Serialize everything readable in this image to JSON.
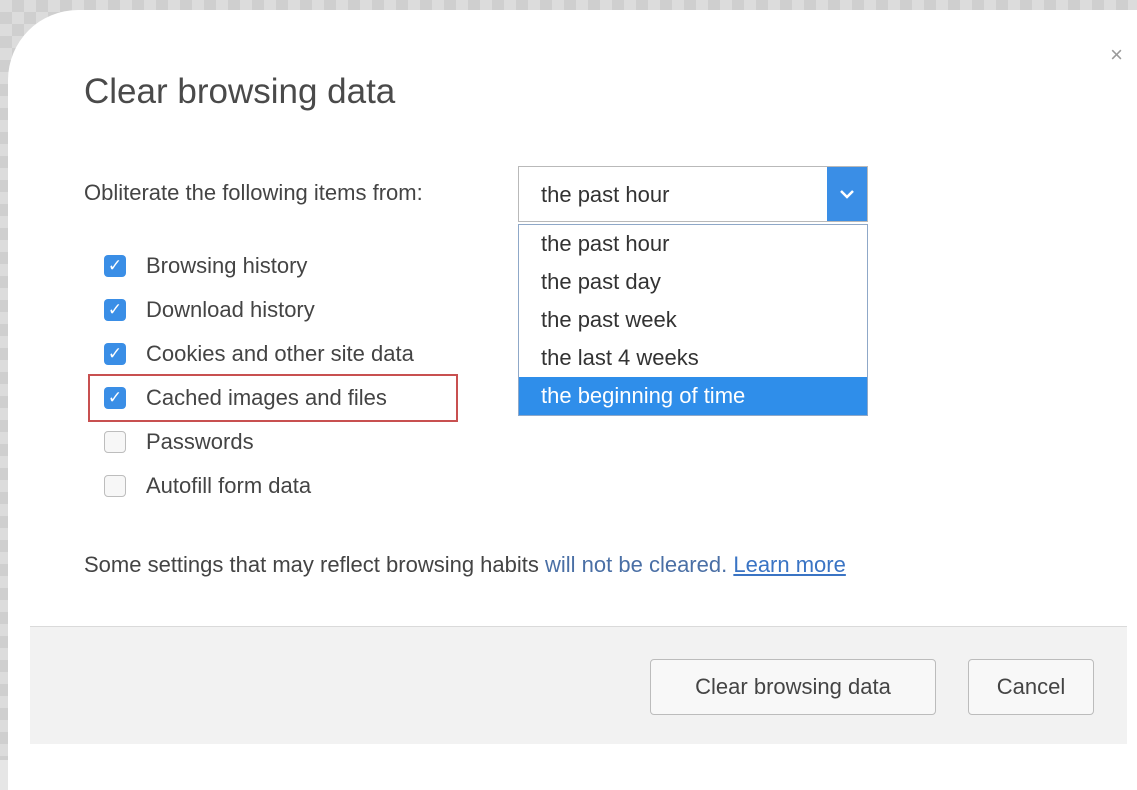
{
  "dialog": {
    "title": "Clear browsing data",
    "close_glyph": "×"
  },
  "range": {
    "label": "Obliterate the following items from:",
    "selected": "the past hour",
    "options": [
      "the past hour",
      "the past day",
      "the past week",
      "the last 4 weeks",
      "the beginning of time"
    ],
    "highlighted_option": "the beginning of time"
  },
  "items": [
    {
      "label": "Browsing history",
      "checked": true
    },
    {
      "label": "Download history",
      "checked": true
    },
    {
      "label": "Cookies and other site data",
      "checked": true
    },
    {
      "label": "Cached images and files",
      "checked": true
    },
    {
      "label": "Passwords",
      "checked": false
    },
    {
      "label": "Autofill form data",
      "checked": false
    }
  ],
  "note": {
    "text": "Some settings that may reflect browsing habits ",
    "highlight": "will not be cleared.",
    "link": "Learn more"
  },
  "buttons": {
    "clear": "Clear browsing data",
    "cancel": "Cancel"
  },
  "colors": {
    "accent": "#3a8ee6",
    "highlight_border": "#c85050",
    "link": "#3a74c4"
  },
  "icons": {
    "check": "✓",
    "dropdown_arrow": "⌄"
  }
}
